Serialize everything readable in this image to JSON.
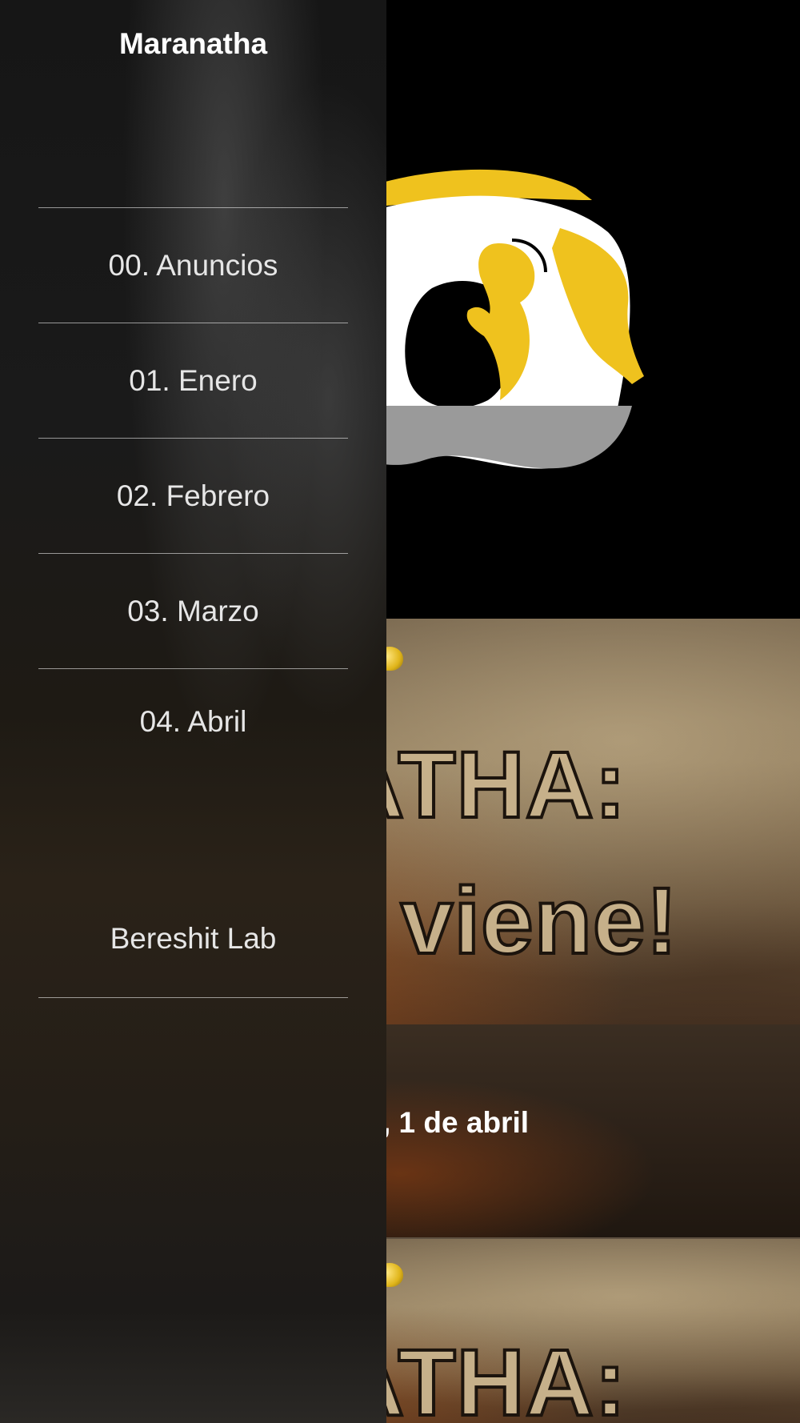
{
  "drawer": {
    "title": "Maranatha",
    "items": [
      {
        "label": "00. Anuncios"
      },
      {
        "label": "01. Enero"
      },
      {
        "label": "02. Febrero"
      },
      {
        "label": "03. Marzo"
      },
      {
        "label": "04. Abril"
      }
    ],
    "extra_item": {
      "label": "Bereshit Lab"
    }
  },
  "content": {
    "card1": {
      "poster_line1": "ATHA:",
      "poster_line2": "r viene!"
    },
    "info_bar": {
      "date_text": ", 1 de abril"
    },
    "card2": {
      "poster_line1": "ATHA:"
    }
  },
  "colors": {
    "logo_yellow": "#EFC21E",
    "logo_white": "#FFFFFF",
    "logo_gray": "#9A9A9A",
    "header_background": "#000000"
  },
  "icons": {
    "logo": "maranatha-angel-logo",
    "pin": "pushpin-icon"
  }
}
